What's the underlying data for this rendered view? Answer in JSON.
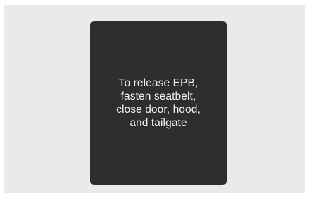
{
  "display": {
    "message_lines": [
      "To release EPB,",
      "fasten seatbelt,",
      "close door, hood,",
      "and tailgate"
    ]
  }
}
